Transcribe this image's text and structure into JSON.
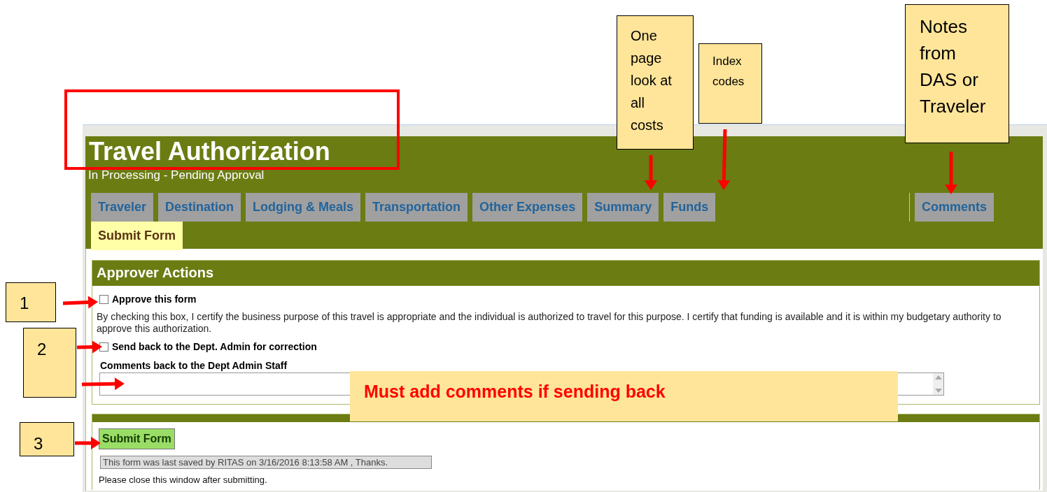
{
  "form": {
    "title": "Travel Authorization",
    "status": "In Processing - Pending Approval",
    "tab_rows": [
      [
        {
          "label": "Traveler",
          "selected": false
        },
        {
          "label": "Destination",
          "selected": false
        },
        {
          "label": "Lodging & Meals",
          "selected": false
        },
        {
          "label": "Transportation",
          "selected": false
        },
        {
          "label": "Other Expenses",
          "selected": false
        },
        {
          "label": "Summary",
          "selected": false
        },
        {
          "label": "Funds",
          "selected": false
        },
        {
          "label": "Comments",
          "selected": false,
          "kind": "aside"
        }
      ],
      [
        {
          "label": "Submit Form",
          "selected": true
        }
      ]
    ],
    "approver_actions": {
      "title": "Approver Actions",
      "options": [
        {
          "label": "Approve this form",
          "checked": false,
          "description": "By checking this box, I certify the business purpose of this travel is appropriate and the individual is authorized to travel for this purpose. I certify that funding is available and it is within my budgetary authority to approve this authorization."
        },
        {
          "label": "Send back to the Dept. Admin for correction",
          "checked": false
        }
      ],
      "comments_label": "Comments back to the Dept Admin Staff"
    },
    "submit": {
      "button": "Submit Form",
      "saved_message": "This form was last saved by RITAS on 3/16/2016 8:13:58 AM , Thanks.",
      "closing_note": "Please close this window after submitting."
    }
  },
  "annotations": {
    "callouts": [
      "One page look at all costs",
      "Index codes",
      "Notes from DAS or Traveler"
    ],
    "markers": [
      "1",
      "2",
      "3"
    ],
    "note": "Must add comments if sending back"
  }
}
